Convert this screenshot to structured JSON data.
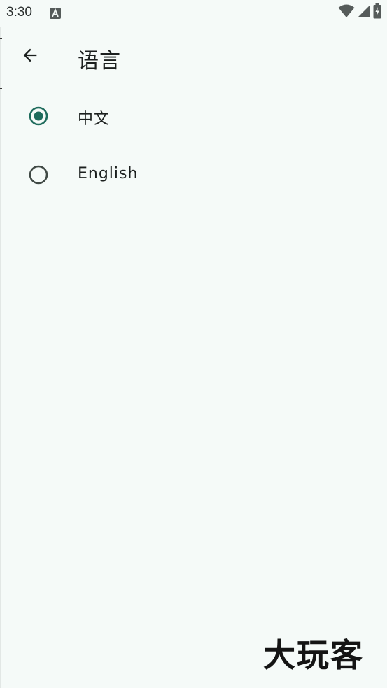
{
  "status_bar": {
    "time": "3:30",
    "icons": [
      "a-notification-icon",
      "wifi-icon",
      "cellular-signal-icon",
      "battery-charging-icon"
    ]
  },
  "app_bar": {
    "back_icon": "arrow-back-icon",
    "title": "语言"
  },
  "language_options": [
    {
      "label": "中文",
      "selected": true
    },
    {
      "label": "English",
      "selected": false
    }
  ],
  "watermark": "大玩客",
  "colors": {
    "background": "#f5faf8",
    "accent": "#1e6b5c",
    "text": "#1b1f1e",
    "radio_unselected": "#404945"
  }
}
